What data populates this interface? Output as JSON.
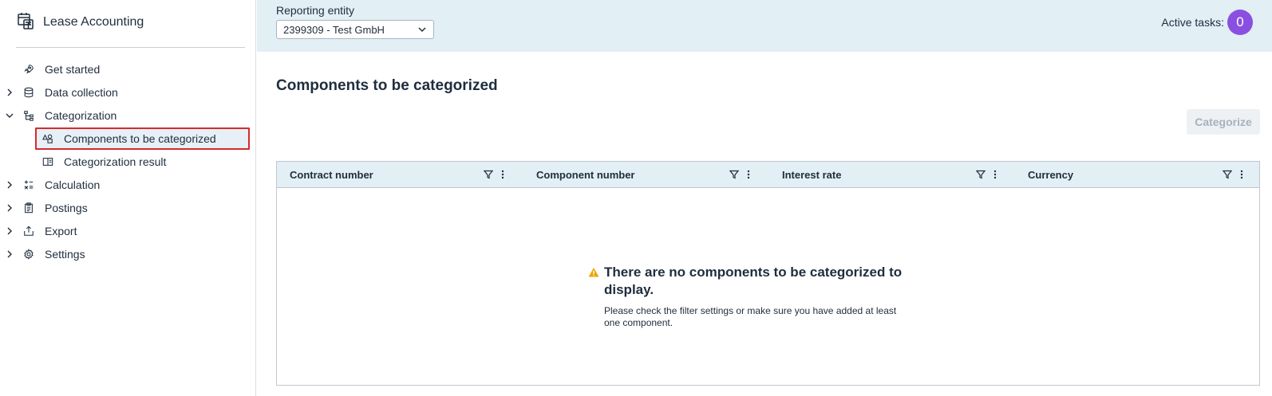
{
  "app": {
    "title": "Lease Accounting"
  },
  "sidebar": {
    "items": [
      {
        "label": "Get started",
        "icon": "rocket-icon",
        "expandable": false
      },
      {
        "label": "Data collection",
        "icon": "database-icon",
        "expandable": true
      },
      {
        "label": "Categorization",
        "icon": "hierarchy-icon",
        "expandable": true,
        "expanded": true
      },
      {
        "label": "Components to be categorized",
        "icon": "shapes-icon",
        "sub": true,
        "selected": true
      },
      {
        "label": "Categorization result",
        "icon": "book-icon",
        "sub": true
      },
      {
        "label": "Calculation",
        "icon": "calculator-icon",
        "expandable": true
      },
      {
        "label": "Postings",
        "icon": "clipboard-icon",
        "expandable": true
      },
      {
        "label": "Export",
        "icon": "export-icon",
        "expandable": true
      },
      {
        "label": "Settings",
        "icon": "gear-icon",
        "expandable": true
      }
    ]
  },
  "topbar": {
    "entity_label": "Reporting entity",
    "entity_value": "2399309 - Test GmbH",
    "tasks_label": "Active tasks:",
    "tasks_count": "0"
  },
  "main": {
    "title": "Components to be categorized",
    "categorize_label": "Categorize",
    "columns": [
      "Contract number",
      "Component number",
      "Interest rate",
      "Currency"
    ],
    "empty_title": "There are no components to be categorized to display.",
    "empty_desc": "Please check the filter settings or make sure you have added at least one component."
  },
  "colors": {
    "accent": "#8a4fe0",
    "header_bg": "#e2eff5",
    "selection_border": "#d52b2b",
    "warning": "#f0a500"
  }
}
